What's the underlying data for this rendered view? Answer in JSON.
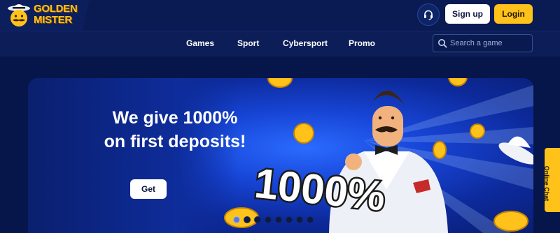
{
  "brand": {
    "line1": "GOLDEN",
    "line2": "MISTER"
  },
  "header": {
    "support_icon": "headset-icon",
    "signup_label": "Sign up",
    "login_label": "Login"
  },
  "nav": {
    "items": [
      {
        "label": "Games"
      },
      {
        "label": "Sport"
      },
      {
        "label": "Cybersport"
      },
      {
        "label": "Promo"
      }
    ]
  },
  "search": {
    "placeholder": "Search a game",
    "icon": "search-icon"
  },
  "hero": {
    "title_line1": "We give 1000%",
    "title_line2": "on first deposits!",
    "cta_label": "Get",
    "badge_text": "1000%"
  },
  "carousel": {
    "total_slides": 8,
    "active_index": 0
  },
  "chat": {
    "label": "Online Chat"
  },
  "colors": {
    "accent": "#ffc21a",
    "background": "#07164a",
    "header": "#0a1a52",
    "hero_blue": "#1745d6"
  }
}
